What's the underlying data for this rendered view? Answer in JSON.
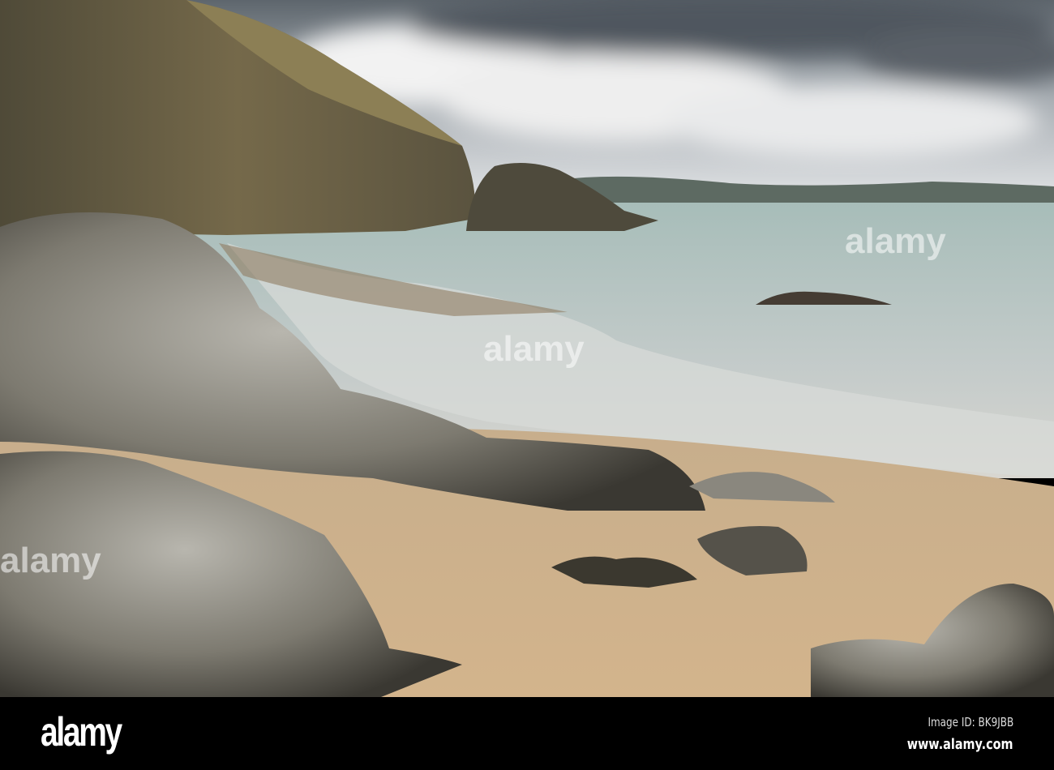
{
  "scene": {
    "description_colors": {
      "sky": "#9aa3ab",
      "sea": "#a9bcb8",
      "sand": "#cdae86",
      "cliff": "#6e6443",
      "rock": "#7a7a74"
    }
  },
  "watermark": {
    "text": "alamy"
  },
  "footer": {
    "logo": "alamy",
    "image_id": "Image ID: BK9JBB",
    "url": "www.alamy.com"
  }
}
